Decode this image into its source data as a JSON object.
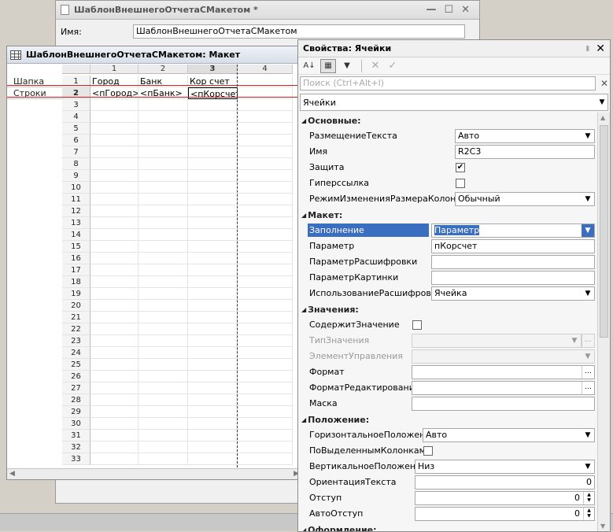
{
  "form_window": {
    "title": "ШаблонВнешнегоОтчетаСМакетом *",
    "name_label": "Имя:",
    "name_value": "ШаблонВнешнегоОтчетаСМакетом"
  },
  "sheet": {
    "title": "ШаблонВнешнегоОтчетаСМакетом: Макет",
    "columns": [
      "1",
      "2",
      "3",
      "4"
    ],
    "areas": [
      "Шапка",
      "Строки"
    ],
    "rows": [
      "1",
      "2",
      "3",
      "4",
      "5",
      "6",
      "7",
      "8",
      "9",
      "10",
      "11",
      "12",
      "13",
      "14",
      "15",
      "16",
      "17",
      "18",
      "19",
      "20",
      "21",
      "22",
      "23",
      "24",
      "25",
      "26",
      "27",
      "28",
      "29",
      "30",
      "31",
      "32",
      "33"
    ],
    "header_cells": [
      "Город",
      "Банк",
      "Кор счет"
    ],
    "data_cells": [
      "<пГород>",
      "<пБанк>",
      "<пКорсчет>"
    ]
  },
  "props": {
    "title": "Свойства: Ячейки",
    "search_placeholder": "Поиск (Ctrl+Alt+I)",
    "object": "Ячейки",
    "sections": {
      "basic": "Основные:",
      "layout": "Макет:",
      "values": "Значения:",
      "position": "Положение:",
      "design": "Оформление:"
    },
    "basic": {
      "text_placement_label": "РазмещениеТекста",
      "text_placement_value": "Авто",
      "name_label": "Имя",
      "name_value": "R2C3",
      "protection_label": "Защита",
      "protection_checked": true,
      "hyperlink_label": "Гиперссылка",
      "hyperlink_checked": false,
      "resize_mode_label": "РежимИзмененияРазмераКолонки",
      "resize_mode_value": "Обычный"
    },
    "layout": {
      "fill_label": "Заполнение",
      "fill_value": "Параметр",
      "param_label": "Параметр",
      "param_value": "пКорсчет",
      "decode_param_label": "ПараметрРасшифровки",
      "decode_param_value": "",
      "picture_param_label": "ПараметрКартинки",
      "picture_param_value": "",
      "decode_usage_label": "ИспользованиеРасшифровки",
      "decode_usage_value": "Ячейка"
    },
    "values": {
      "contains_value_label": "СодержитЗначение",
      "contains_value_checked": false,
      "value_type_label": "ТипЗначения",
      "control_label": "ЭлементУправления",
      "format_label": "Формат",
      "edit_format_label": "ФорматРедактирования",
      "mask_label": "Маска"
    },
    "position": {
      "h_align_label": "ГоризонтальноеПоложение",
      "h_align_value": "Авто",
      "by_selected_label": "ПоВыделеннымКолонкам",
      "by_selected_checked": false,
      "v_align_label": "ВертикальноеПоложение",
      "v_align_value": "Низ",
      "orientation_label": "ОриентацияТекста",
      "orientation_value": "0",
      "indent_label": "Отступ",
      "indent_value": "0",
      "auto_indent_label": "АвтоОтступ",
      "auto_indent_value": "0"
    }
  }
}
